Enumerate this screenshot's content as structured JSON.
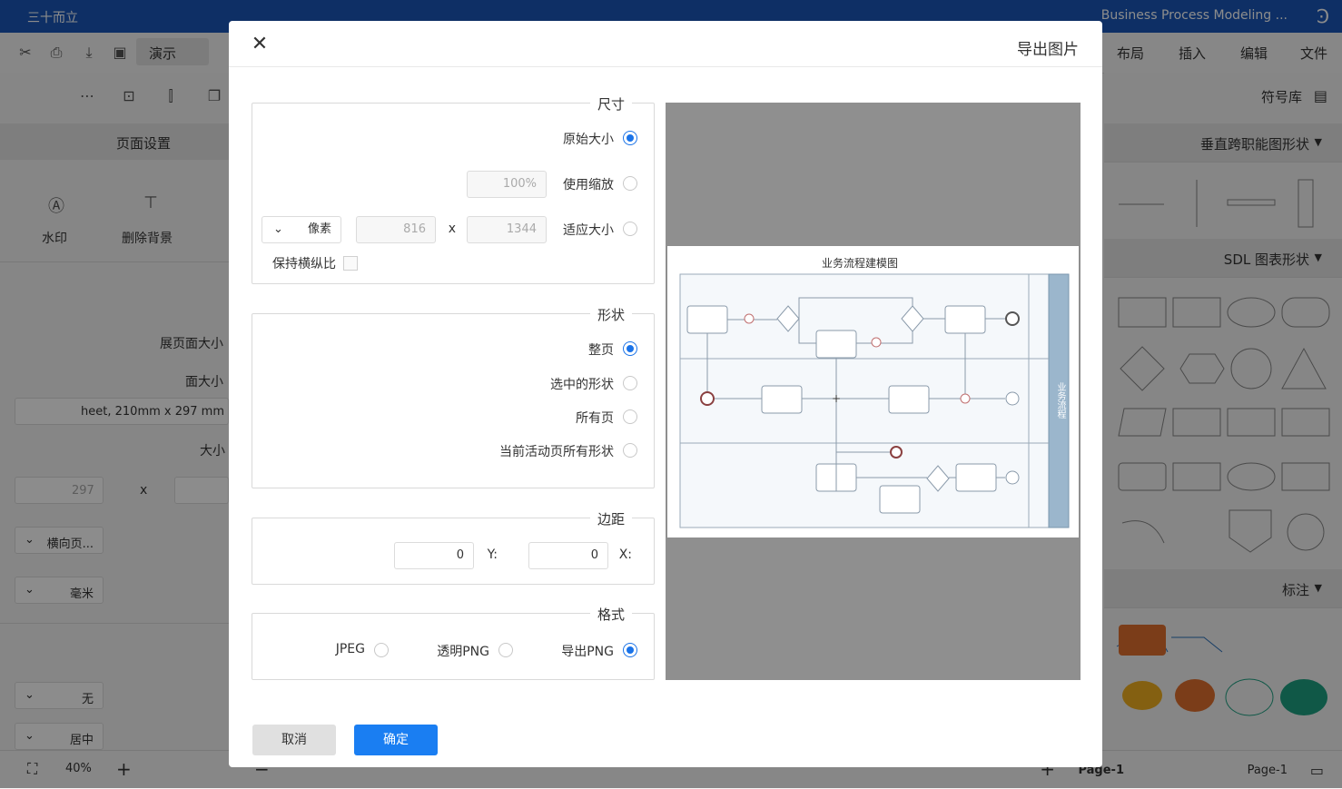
{
  "window": {
    "title": "Business Process Modeling ...",
    "user": "三十而立"
  },
  "menu": {
    "file": "文件",
    "edit": "编辑",
    "insert": "插入",
    "layout": "布局",
    "present": "演示"
  },
  "library": {
    "title": "符号库",
    "sections": [
      "垂直跨职能图形状",
      "SDL 图表形状",
      "标注"
    ]
  },
  "page_settings": {
    "title": "页面设置",
    "watermark": "水印",
    "remove_background": "删除背景",
    "fit_page_size": "展页面大小",
    "page_size_label": "面大小",
    "page_size_value": "heet, 210mm x 297 mm",
    "size_label": "大小",
    "height_value": "297",
    "x_sep": "x",
    "orientation": "横向页...",
    "unit": "毫米",
    "none": "无",
    "center": "居中"
  },
  "statusbar": {
    "page_tab": "Page-1",
    "page_tab_active": "Page-1",
    "zoom": "40%"
  },
  "dialog": {
    "title": "导出图片",
    "size": {
      "legend": "尺寸",
      "original": "原始大小",
      "scale": "使用缩放",
      "scale_value": "100%",
      "fit": "适应大小",
      "width": "1344",
      "x": "x",
      "height": "816",
      "unit": "像素",
      "keep_ratio": "保持横纵比"
    },
    "shape": {
      "legend": "形状",
      "whole_page": "整页",
      "selected": "选中的形状",
      "all_pages": "所有页",
      "current_page_all": "当前活动页所有形状"
    },
    "margin": {
      "legend": "边距",
      "x_label": "X:",
      "x_value": "0",
      "y_label": "Y:",
      "y_value": "0"
    },
    "format": {
      "legend": "格式",
      "png": "导出PNG",
      "transparent_png": "透明PNG",
      "jpeg": "JPEG"
    },
    "preview": {
      "diagram_title": "业务流程建模图",
      "lane_label": "业务流程"
    },
    "confirm": "确定",
    "cancel": "取消"
  }
}
